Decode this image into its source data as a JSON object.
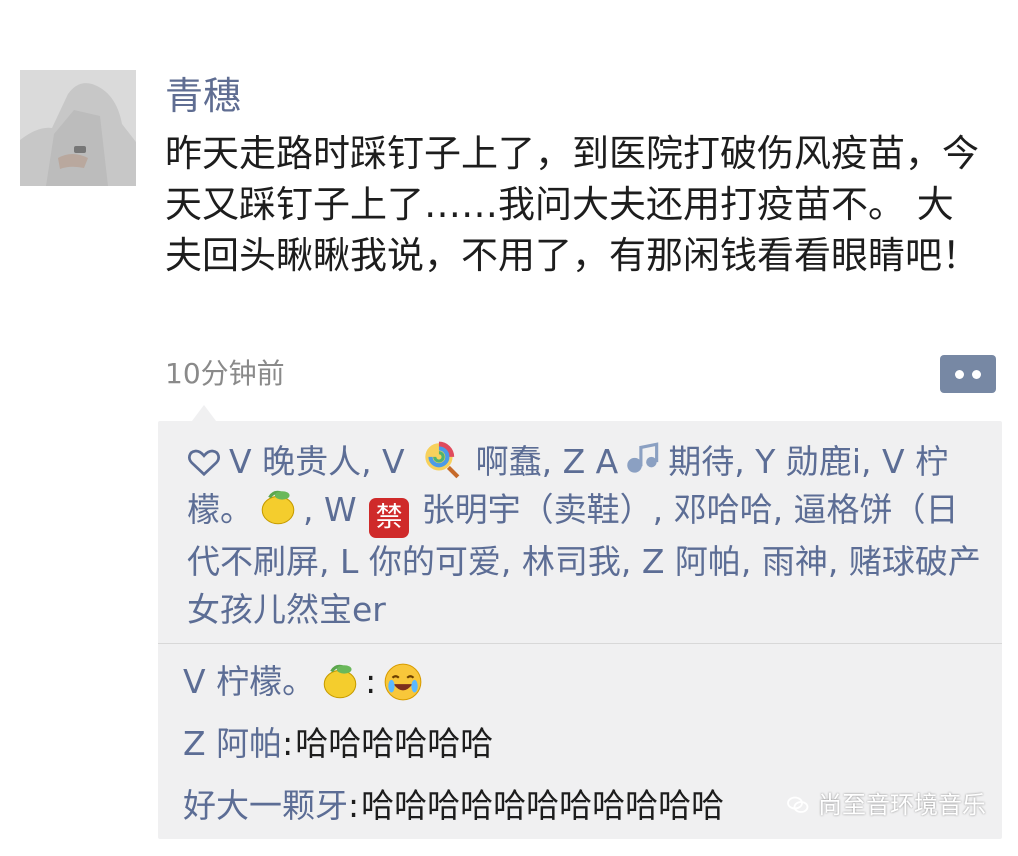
{
  "post": {
    "author": "青穗",
    "text": "昨天走路时踩钉子上了，到医院打破伤风疫苗，今天又踩钉子上了……我问大夫还用打疫苗不。 大夫回头瞅瞅我说，不用了，有那闲钱看看眼睛吧！",
    "time": "10分钟前"
  },
  "likes": {
    "segments": [
      {
        "text": "V 晚贵人, V "
      },
      {
        "emoji": "lollipop"
      },
      {
        "text": " 啊蠢, Z A"
      },
      {
        "emoji": "music"
      },
      {
        "text": "期待, Y 勋鹿i, V 柠檬。"
      },
      {
        "emoji": "lemon"
      },
      {
        "text": ", W "
      },
      {
        "badge": "禁"
      },
      {
        "text": " 张明宇（卖鞋）, 邓哈哈, 逼格饼（日代不刷屏, L 你的可爱, 林司我, Z 阿帕, 雨神, 赌球破产女孩儿然宝er"
      }
    ]
  },
  "comments": [
    {
      "name": "V 柠檬。",
      "emoji": "lemon",
      "sep": ":",
      "text": "",
      "reaction": "laugh-cry"
    },
    {
      "name": "Z 阿帕",
      "sep": ": ",
      "text": "哈哈哈哈哈哈"
    },
    {
      "name": "好大一颗牙",
      "sep": ": ",
      "text": "哈哈哈哈哈哈哈哈哈哈哈"
    }
  ],
  "watermark": "尚至音环境音乐",
  "colors": {
    "link": "#5c6d95",
    "username": "#5f6d92",
    "panel": "#f0f0f1",
    "timestamp": "#8a8a8a",
    "action_button": "#7788a4",
    "badge_red": "#cf2a2a"
  }
}
